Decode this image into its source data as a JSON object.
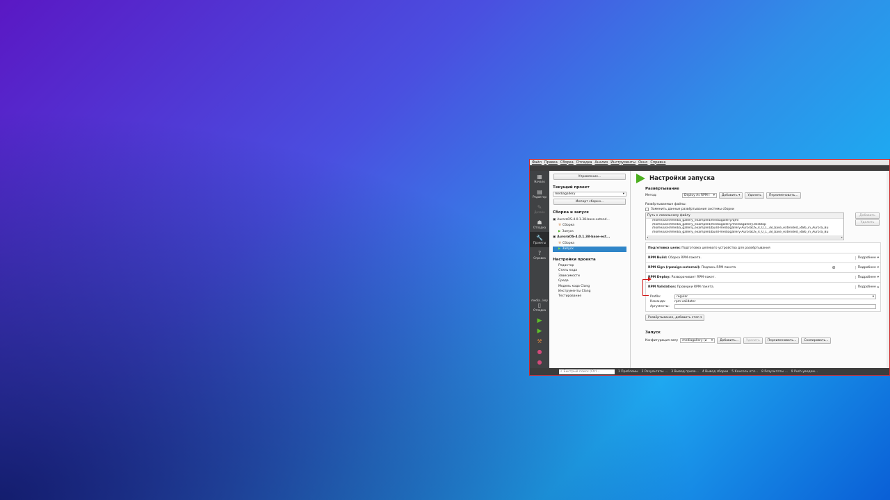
{
  "menu": [
    "Файл",
    "Правка",
    "Сборка",
    "Отладка",
    "Анализ",
    "Инструменты",
    "Окно",
    "Справка"
  ],
  "modes": [
    {
      "icon": "grid-icon",
      "label": "Начало",
      "glyph": "▦"
    },
    {
      "icon": "editor-icon",
      "label": "Редактор",
      "glyph": "▤"
    },
    {
      "icon": "design-icon",
      "label": "Дизайн",
      "glyph": "✎"
    },
    {
      "icon": "debug-icon",
      "label": "Отладка",
      "glyph": "☗"
    },
    {
      "icon": "wrench-icon",
      "label": "Проекты",
      "glyph": "🔧"
    },
    {
      "icon": "help-icon",
      "label": "Справка",
      "glyph": "?"
    }
  ],
  "kit": {
    "name": "media...lery",
    "mode": "Отладка"
  },
  "nav": {
    "manage_button": "Управление...",
    "current_project_title": "Текущий проект",
    "current_project": "mediagallery",
    "import_button": "Импорт сборки...",
    "build_run_title": "Сборка и запуск",
    "tree": [
      {
        "label": "AuroraOS-4.0.1.38-base-extend...",
        "level": 0
      },
      {
        "label": "Сборка",
        "level": 1
      },
      {
        "label": "Запуск",
        "level": 1
      },
      {
        "label": "AuroraOS-4.0.1.38-base-ext...",
        "level": 0
      },
      {
        "label": "Сборка",
        "level": 1
      },
      {
        "label": "Запуск",
        "level": 1
      }
    ],
    "project_settings_title": "Настройки проекта",
    "project_settings": [
      "Редактор",
      "Стиль кода",
      "Зависимости",
      "Среда",
      "Модель кода Clang",
      "Инструменты Clang",
      "Тестирование"
    ]
  },
  "main": {
    "title": "Настройки запуска",
    "deploy_section": "Развёртывание",
    "method_label": "Метод:",
    "method_value": "Deploy As RPM I",
    "add_button": "Добавить",
    "remove_button": "Удалить",
    "rename_button": "Переименовать...",
    "deployed_files_label": "Развёртываемые файлы:",
    "override_checkbox": "Заменить данные развёртывания системы сборки",
    "file_header": "Путь к локальному файлу",
    "files": [
      "/home/user/media_gallery_example4/mediagallery/qml",
      "/home/user/media_gallery_example4/mediagallery/mediagallery.desktop",
      "/home/user/media_gallery_example4/build-mediagallery-AuroraOS_4_0_1_38_base_extended_i486_in_Aurora_Bu",
      "/home/user/media_gallery_example4/build-mediagallery-AuroraOS_4_0_1_38_base_extended_i486_in_Aurora_Bu"
    ],
    "file_add": "Добавить",
    "file_remove": "Удалить",
    "steps": [
      {
        "name": "Подготовка цели:",
        "desc": "Подготовка целевого устройства для развёртывания",
        "more": ""
      },
      {
        "name": "RPM Build:",
        "desc": "Сборка RPM-пакета.",
        "more": "Подробнее"
      },
      {
        "name": "RPM Sign (rpmsign-external):",
        "desc": "Подпись RPM пакета",
        "more": "Подробнее"
      },
      {
        "name": "RPM Deploy:",
        "desc": "Разворачивает RPM-пакет.",
        "more": "Подробнее"
      },
      {
        "name": "RPM Validation:",
        "desc": "Проверки RPM пакета.",
        "more": "Подробнее"
      }
    ],
    "validation": {
      "profile_label": "Profile:",
      "profile_value": "regular",
      "command_label": "Команда:",
      "command_value": "rpm-validator",
      "args_label": "Аргументы:",
      "args_value": ""
    },
    "add_step_button": "Развёртывание, добавить этап",
    "run_section": "Запуск",
    "run_config_label": "Конфигурация запу",
    "run_config_value": "mediagallery (и",
    "run_add": "Добавить...",
    "run_remove": "Удалить",
    "run_rename": "Переименовать...",
    "run_copy": "Скопировать..."
  },
  "statusbar": {
    "search_placeholder": "Быстрый поиск (Ctrl...",
    "tabs": [
      "1 Проблемы",
      "2 Результаты ...",
      "3 Вывод прило...",
      "4 Вывод сборки",
      "5 Консоль отл...",
      "8 Результаты ...",
      "9 Push-уведом..."
    ]
  },
  "colors": {
    "accent": "#2f85c8",
    "highlight": "#d01818",
    "run_green": "#5fbf2a"
  }
}
